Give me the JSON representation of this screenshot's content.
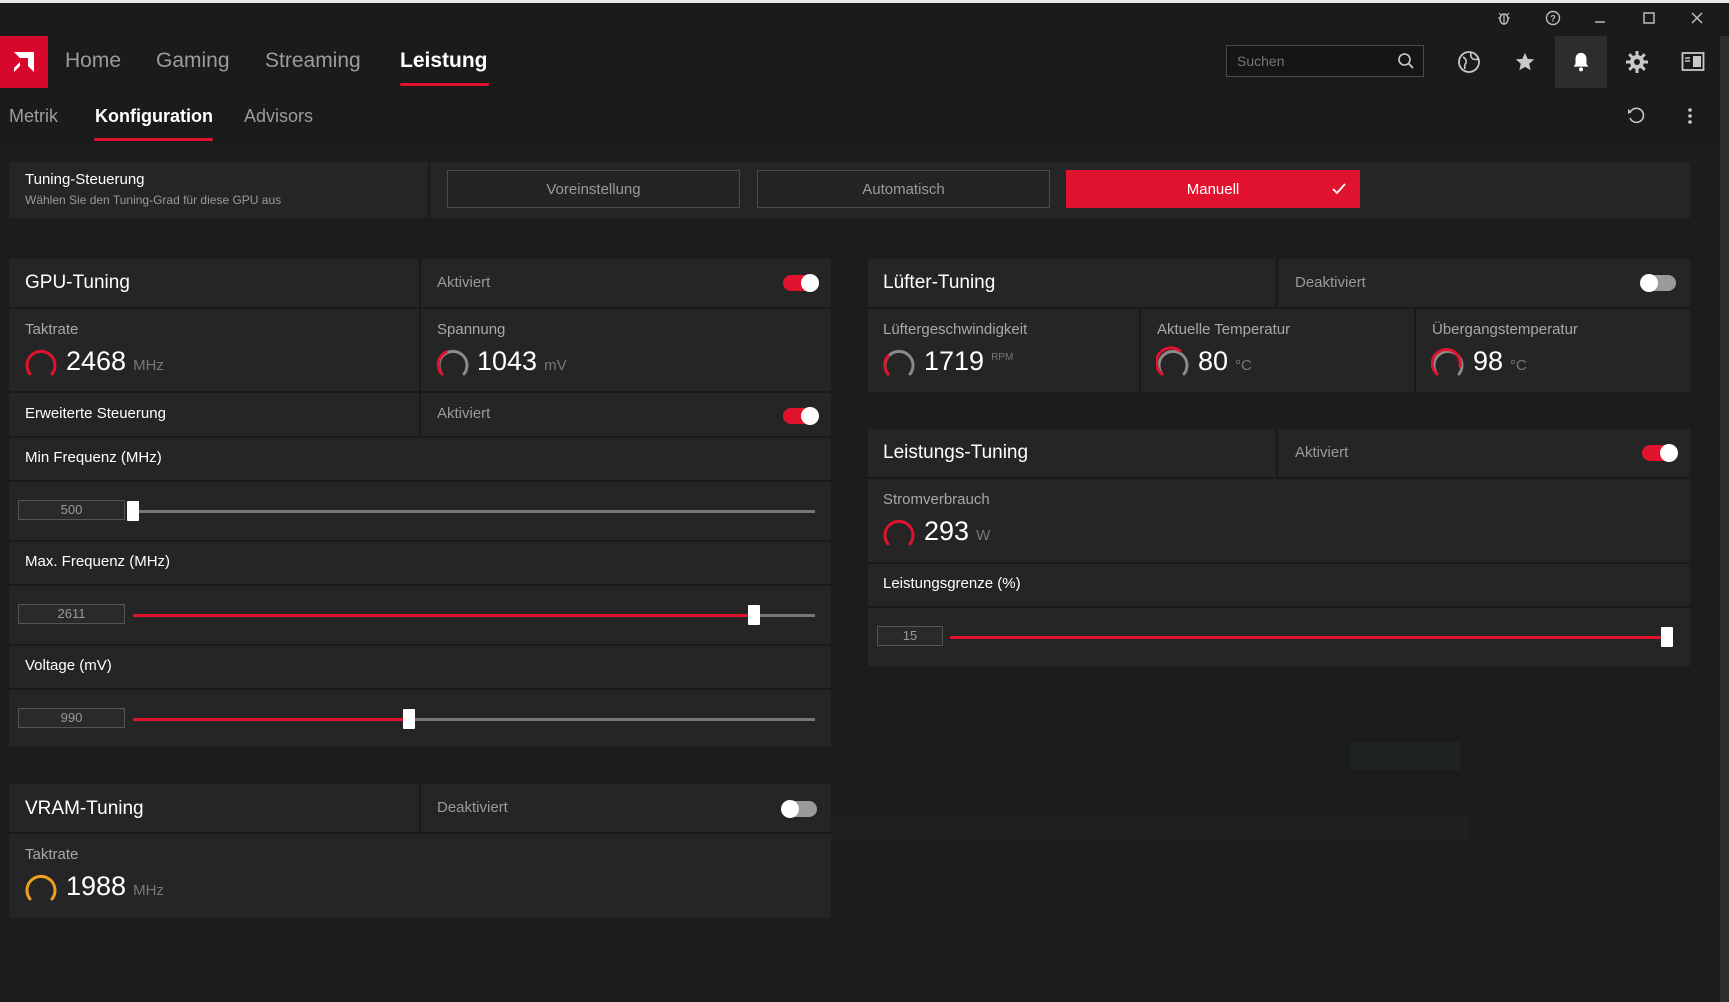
{
  "window": {
    "controls": [
      "bug-report",
      "help",
      "minimize",
      "maximize",
      "close"
    ]
  },
  "nav": {
    "tabs": [
      {
        "label": "Home"
      },
      {
        "label": "Gaming"
      },
      {
        "label": "Streaming"
      },
      {
        "label": "Leistung"
      }
    ],
    "active_tab": "Leistung",
    "search_placeholder": "Suchen"
  },
  "subnav": {
    "tabs": [
      {
        "label": "Metrik"
      },
      {
        "label": "Konfiguration"
      },
      {
        "label": "Advisors"
      }
    ],
    "active_tab": "Konfiguration"
  },
  "tuning_control": {
    "title": "Tuning-Steuerung",
    "subtitle": "Wählen Sie den Tuning-Grad für diese GPU aus",
    "options": [
      {
        "label": "Voreinstellung"
      },
      {
        "label": "Automatisch"
      },
      {
        "label": "Manuell"
      }
    ],
    "selected": "Manuell"
  },
  "gpu_tuning": {
    "title": "GPU-Tuning",
    "status": "Aktiviert",
    "enabled": true,
    "clock": {
      "label": "Taktrate",
      "value": "2468",
      "unit": "MHz"
    },
    "voltage": {
      "label": "Spannung",
      "value": "1043",
      "unit": "mV"
    },
    "advanced": {
      "title": "Erweiterte Steuerung",
      "status": "Aktiviert",
      "enabled": true
    },
    "min_freq": {
      "label": "Min Frequenz (MHz)",
      "value": "500",
      "level": 0.0
    },
    "max_freq": {
      "label": "Max. Frequenz (MHz)",
      "value": "2611",
      "level": 0.91
    },
    "voltage_slider": {
      "label": "Voltage (mV)",
      "value": "990",
      "level": 0.405
    }
  },
  "fan_tuning": {
    "title": "Lüfter-Tuning",
    "status": "Deaktiviert",
    "enabled": false,
    "fan_speed": {
      "label": "Lüftergeschwindigkeit",
      "value": "1719",
      "unit": "RPM"
    },
    "current_temp": {
      "label": "Aktuelle Temperatur",
      "value": "80",
      "unit": "°C"
    },
    "junction_temp": {
      "label": "Übergangstemperatur",
      "value": "98",
      "unit": "°C"
    }
  },
  "power_tuning": {
    "title": "Leistungs-Tuning",
    "status": "Aktiviert",
    "enabled": true,
    "power": {
      "label": "Stromverbrauch",
      "value": "293",
      "unit": "W"
    },
    "limit": {
      "label": "Leistungsgrenze (%)",
      "value": "15",
      "level": 1.0
    }
  },
  "vram_tuning": {
    "title": "VRAM-Tuning",
    "status": "Deaktiviert",
    "enabled": false,
    "clock": {
      "label": "Taktrate",
      "value": "1988",
      "unit": "MHz"
    }
  },
  "colors": {
    "accent": "#e0122e",
    "gauge_red": "#e0122e",
    "gauge_amber": "#f0a020",
    "gauge_grey": "#8a8a8a"
  }
}
